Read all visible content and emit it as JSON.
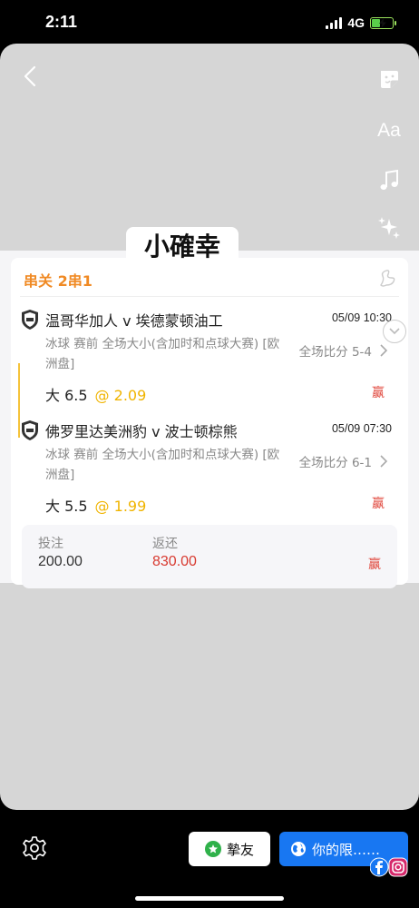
{
  "status": {
    "time": "2:11",
    "network": "4G"
  },
  "icons": {
    "back": "chevron-left-icon",
    "sticker": "sticker-icon",
    "text_tool": "Aa",
    "music": "music-note-icon",
    "effects": "sparkles-icon",
    "settings": "gear-icon"
  },
  "caption": "小確幸",
  "ticket": {
    "type": "串关 2串1",
    "matches": [
      {
        "teams": "温哥华加人 v 埃德蒙顿油工",
        "time": "05/09 10:30",
        "desc": "冰球  赛前   全场大小(含加时和点球大赛) [欧洲盘]",
        "score": "全场比分 5-4",
        "pick": "大 6.5",
        "odds": "@ 2.09",
        "result": "赢"
      },
      {
        "teams": "佛罗里达美洲豹 v 波士顿棕熊",
        "time": "05/09 07:30",
        "desc": "冰球  赛前   全场大小(含加时和点球大赛) [欧洲盘]",
        "score": "全场比分 6-1",
        "pick": "大 5.5",
        "odds": "@ 1.99",
        "result": "赢"
      }
    ],
    "summary": {
      "stake_label": "投注",
      "stake": "200.00",
      "return_label": "返还",
      "return": "830.00",
      "result": "赢"
    }
  },
  "bottom": {
    "friends_label": "摯友",
    "story_label": "你的限……"
  },
  "colors": {
    "accent_orange": "#f08a24",
    "odds_yellow": "#f0b400",
    "win_red": "#e0453a",
    "facebook_blue": "#1877f2"
  }
}
